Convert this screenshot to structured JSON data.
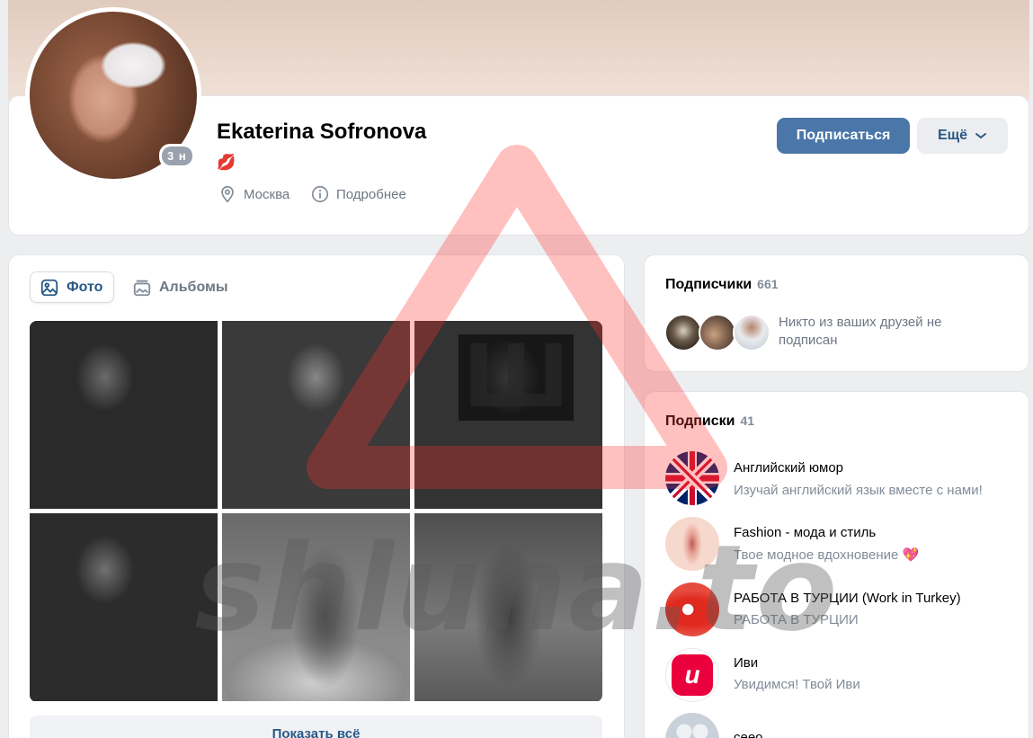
{
  "profile": {
    "name": "Ekaterina Sofronova",
    "status_emoji": "💋",
    "online": "3 н",
    "city": "Москва",
    "details": "Подробнее",
    "subscribe_label": "Подписаться",
    "more_label": "Ещё"
  },
  "photos": {
    "tabs": [
      {
        "label": "Фото",
        "active": true
      },
      {
        "label": "Альбомы",
        "active": false
      }
    ],
    "show_all": "Показать всё"
  },
  "followers": {
    "title": "Подписчики",
    "count": "661",
    "friends_note": "Никто из ваших друзей не подписан"
  },
  "subscriptions": {
    "title": "Подписки",
    "count": "41",
    "items": [
      {
        "name": "Английский юмор",
        "desc": "Изучай английский язык вместе с нами!"
      },
      {
        "name": "Fashion - мода и стиль",
        "desc": "Твое модное вдохновение 💖"
      },
      {
        "name": "РАБОТА В ТУРЦИИ (Work in Turkey)",
        "desc": "РАБОТА В ТУРЦИИ"
      },
      {
        "name": "Иви",
        "desc": "Увидимся! Твой Иви"
      },
      {
        "name": "сеео",
        "desc": ""
      }
    ]
  },
  "watermark": {
    "text": "shluha.to",
    "glyph": "Ш"
  },
  "colors": {
    "accent": "#4a76a8",
    "link": "#2a5885",
    "muted": "#818c99",
    "watermark_red": "#ff3030"
  }
}
